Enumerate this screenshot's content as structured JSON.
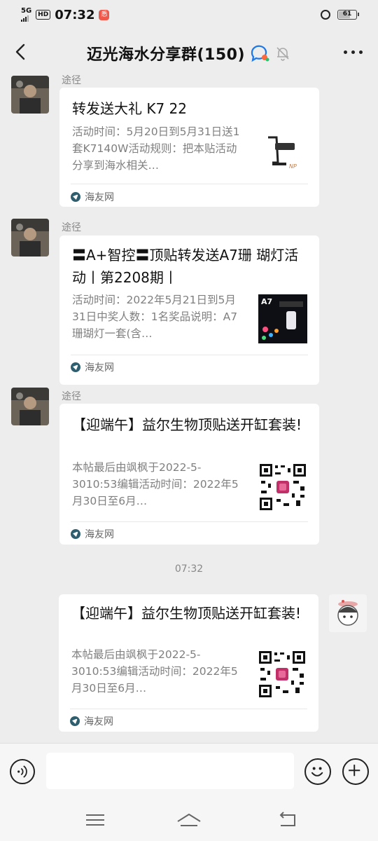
{
  "status_bar": {
    "network": "5G",
    "hd": "HD",
    "time": "07:32",
    "app_badge": "悉",
    "battery": "61"
  },
  "header": {
    "title": "迈光海水分享群(150)",
    "icons": [
      "back-arrow-icon",
      "chat-bubble-icon",
      "mute-bell-icon",
      "more-dots-icon"
    ]
  },
  "messages": [
    {
      "sender": "途径",
      "title": "转发送大礼 K7 22",
      "desc": "活动时间：5月20日到5月31日送1套K7140W活动规则：把本贴活动分享到海水相关…",
      "source": "海友网",
      "thumb": "k7-lamp-image"
    },
    {
      "sender": "途径",
      "title": "〓A+智控〓顶贴转发送A7珊 瑚灯活动丨第2208期丨",
      "desc": "活动时间：2022年5月21日到5月31日中奖人数：1名奖品说明：A7珊瑚灯一套(含…",
      "source": "海友网",
      "thumb_label": "A7",
      "thumb": "a7-lamp-image"
    },
    {
      "sender": "途径",
      "title": "【迎端午】益尔生物顶贴送开缸套装!",
      "desc": "本帖最后由飒枫于2022-5-3010:53编辑活动时间：2022年5月30日至6月…",
      "source": "海友网",
      "thumb": "qr-code-image"
    }
  ],
  "time_divider": "07:32",
  "my_message": {
    "title": "【迎端午】益尔生物顶贴送开缸套装!",
    "desc": "本帖最后由飒枫于2022-5-3010:53编辑活动时间：2022年5月30日至6月…",
    "source": "海友网",
    "thumb": "qr-code-image"
  },
  "input_bar": {
    "placeholder": "",
    "icons": [
      "voice-icon",
      "emoji-icon",
      "plus-icon"
    ]
  },
  "nav_bar": {
    "icons": [
      "menu-icon",
      "home-icon",
      "back-icon"
    ]
  }
}
